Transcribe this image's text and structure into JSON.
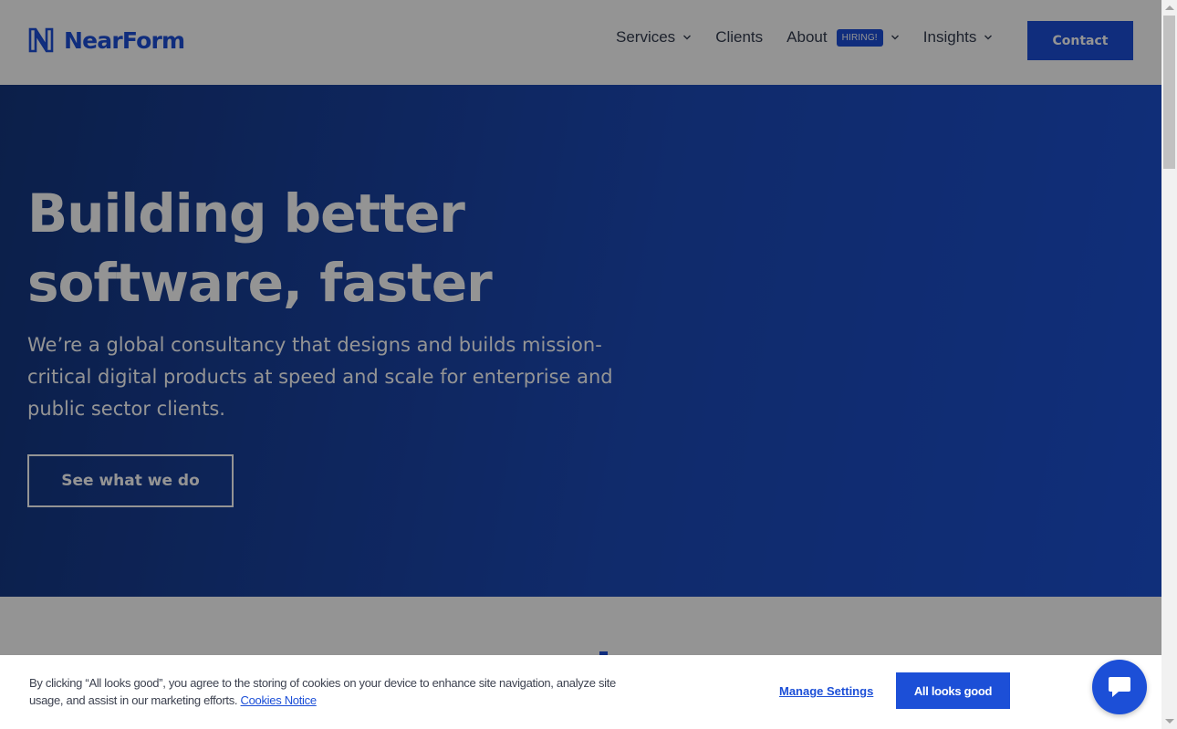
{
  "brand": {
    "name": "NearForm",
    "color": "#1c4fd7"
  },
  "nav": {
    "items": [
      {
        "label": "Services",
        "has_dropdown": true
      },
      {
        "label": "Clients",
        "has_dropdown": false
      },
      {
        "label": "About",
        "badge": "HIRING!",
        "has_dropdown": true
      },
      {
        "label": "Insights",
        "has_dropdown": true
      }
    ],
    "contact_label": "Contact"
  },
  "hero": {
    "title_line1": "Building better",
    "title_line2": "software, faster",
    "description": "We’re a global consultancy that designs and builds mission-critical digital products at speed and scale for enterprise and public sector clients.",
    "cta_label": "See what we do"
  },
  "cookie_banner": {
    "text": "By clicking “All looks good”, you agree to the storing of cookies on your device to enhance site navigation, analyze site usage, and assist in our marketing efforts.",
    "link_label": "Cookies Notice",
    "manage_label": "Manage Settings",
    "accept_label": "All looks good"
  },
  "icons": {
    "chat": "chat-bubble-icon",
    "dropdown": "chevron-down-icon"
  }
}
